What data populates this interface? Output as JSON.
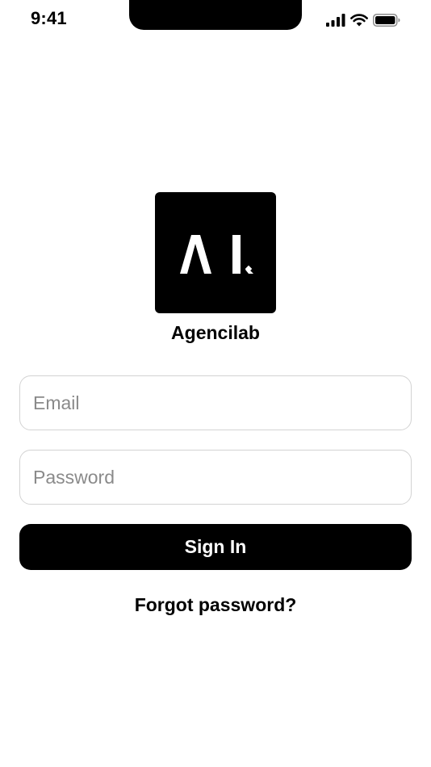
{
  "status_bar": {
    "time": "9:41",
    "icons": [
      "cellular-signal-icon",
      "wifi-icon",
      "battery-icon"
    ]
  },
  "brand": {
    "logo_icon": "agencilab-logo-icon",
    "name": "Agencilab",
    "colors": {
      "primary": "#000000",
      "background": "#ffffff",
      "field_border": "#d3d3d3",
      "placeholder": "#8a8a8a"
    }
  },
  "form": {
    "email": {
      "value": "",
      "placeholder": "Email"
    },
    "password": {
      "value": "",
      "placeholder": "Password"
    },
    "sign_in_label": "Sign In",
    "forgot_password_label": "Forgot password?"
  }
}
